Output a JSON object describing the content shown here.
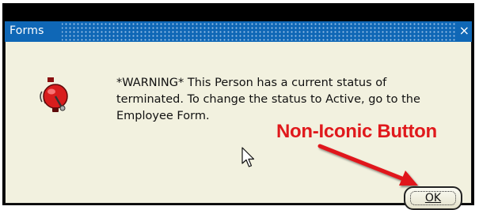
{
  "window": {
    "title": "Forms",
    "close_glyph": "×"
  },
  "icons": {
    "alert": "alarm-bell-icon",
    "close": "close-icon",
    "pointer": "mouse-pointer-icon"
  },
  "message": {
    "lines": [
      "*WARNING* This Person has a current status of",
      "terminated. To change the status to Active, go to the",
      "Employee Form."
    ]
  },
  "annotation": {
    "text": "Non-Iconic Button",
    "color": "#e0191c"
  },
  "buttons": {
    "ok_label": "OK"
  },
  "colors": {
    "titlebar": "#0f67b6",
    "dialog_bg": "#f2f1df"
  }
}
